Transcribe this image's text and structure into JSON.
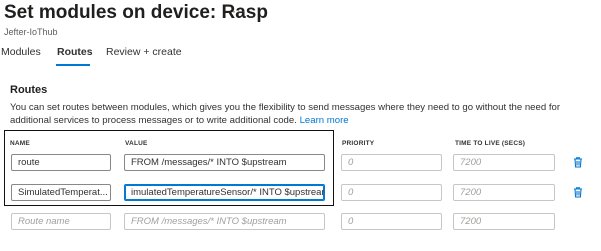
{
  "header": {
    "title": "Set modules on device: Rasp",
    "more_label": "···",
    "subtitle": "Jefter-IoThub"
  },
  "tabs": [
    {
      "label": "Modules",
      "active": false
    },
    {
      "label": "Routes",
      "active": true
    },
    {
      "label": "Review + create",
      "active": false
    }
  ],
  "routes": {
    "heading": "Routes",
    "description": "You can set routes between modules, which gives you the flexibility to send messages where they need to go without the need for additional services to process messages or to write additional code.",
    "learn_more": "Learn more",
    "columns": {
      "name": "NAME",
      "value": "VALUE",
      "priority": "PRIORITY",
      "ttl": "TIME TO LIVE (SECS)"
    },
    "rows": [
      {
        "name": "route",
        "value": "FROM /messages/* INTO $upstream",
        "priority_placeholder": "0",
        "ttl_placeholder": "7200"
      },
      {
        "name": "SimulatedTemperat...",
        "value": "imulatedTemperatureSensor/* INTO $upstream",
        "priority_placeholder": "0",
        "ttl_placeholder": "7200"
      }
    ],
    "new_row": {
      "name_placeholder": "Route name",
      "value_placeholder": "FROM /messages/* INTO $upstream",
      "priority_placeholder": "0",
      "ttl_placeholder": "7200"
    }
  },
  "colors": {
    "accent": "#0078d4",
    "text": "#323130",
    "placeholder": "#a19f9d"
  },
  "icons": {
    "delete": "trash-icon"
  }
}
